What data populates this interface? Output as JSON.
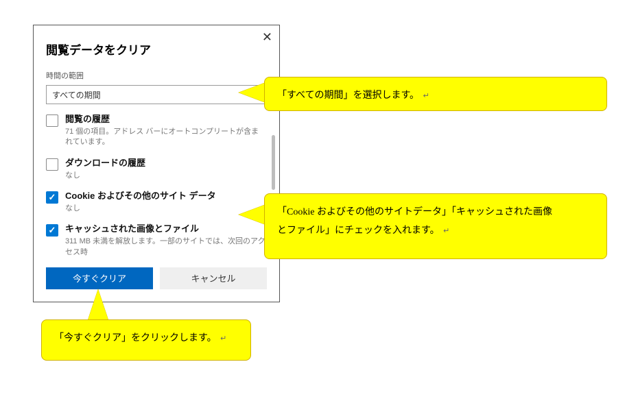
{
  "dialog": {
    "title": "閲覧データをクリア",
    "close": "✕",
    "range_label": "時間の範囲",
    "range_value": "すべての期間",
    "items": [
      {
        "label": "閲覧の履歴",
        "sub": "71 個の項目。アドレス バーにオートコンプリートが含まれています。",
        "checked": false
      },
      {
        "label": "ダウンロードの履歴",
        "sub": "なし",
        "checked": false
      },
      {
        "label": "Cookie およびその他のサイト データ",
        "sub": "なし",
        "checked": true
      },
      {
        "label": "キャッシュされた画像とファイル",
        "sub": "311 MB 未満を解放します。一部のサイトでは、次回のアクセス時",
        "checked": true
      }
    ],
    "clear_button": "今すぐクリア",
    "cancel_button": "キャンセル"
  },
  "callouts": {
    "c1": "「すべての期間」を選択します。",
    "c2a": "「Cookie およびその他のサイトデータ」「キャッシュされた画像",
    "c2b": "とファイル」にチェックを入れます。",
    "c3": "「今すぐクリア」をクリックします。",
    "ret": "↵"
  }
}
